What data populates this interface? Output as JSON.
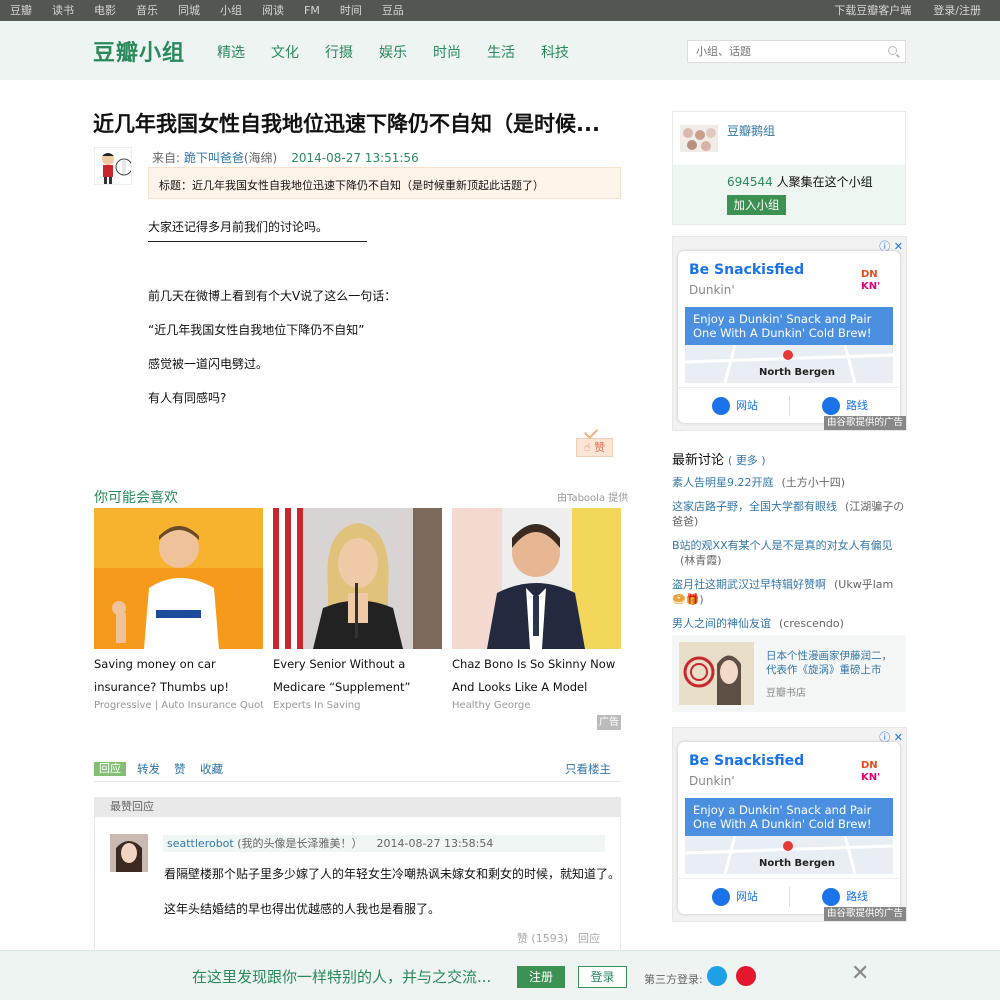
{
  "topbar": {
    "nav": [
      "豆瓣",
      "读书",
      "电影",
      "音乐",
      "同城",
      "小组",
      "阅读",
      "FM",
      "时间",
      "豆品"
    ],
    "download": "下载豆瓣客户端",
    "login": "登录/注册"
  },
  "header": {
    "logo": "豆瓣小组",
    "categories": [
      "精选",
      "文化",
      "行摄",
      "娱乐",
      "时尚",
      "生活",
      "科技"
    ],
    "search_placeholder": "小组、话题"
  },
  "article": {
    "title": "近几年我国女性自我地位迅速下降仍不自知（是时候...",
    "from_label": "来自: ",
    "author": "跪下叫爸爸",
    "location": "(海绵)",
    "date": "2014-08-27 13:51:56",
    "title_box": "标题：近几年我国女性自我地位迅速下降仍不自知（是时候重新顶起此话题了）",
    "paragraphs": [
      "大家还记得多月前我们的讨论吗。",
      "前几天在微博上看到有个大V说了这么一句话：",
      "“近几年我国女性自我地位下降仍不自知”",
      "感觉被一道闪电劈过。",
      "有人有同感吗?"
    ],
    "like_label": "赞"
  },
  "recommend": {
    "title": "你可能会喜欢",
    "source": "由Taboola 提供",
    "cards": [
      {
        "caption": "Saving money on car insurance? Thumbs up!",
        "sponsor": "Progressive | Auto Insurance Quotes"
      },
      {
        "caption": "Every Senior Without a Medicare “Supplement” Policy Should Do...",
        "sponsor": "Experts In Saving"
      },
      {
        "caption": "Chaz Bono Is So Skinny Now And Looks Like A Model (Photos)",
        "sponsor": "Healthy George"
      }
    ],
    "ad_tag": "广告"
  },
  "actions": {
    "reply": "回应",
    "share": "转发",
    "like": "赞",
    "collect": "收藏",
    "op_only": "只看楼主"
  },
  "best_replies": {
    "heading": "最赞回应",
    "reply": {
      "name": "seattlerobot",
      "note": " (我的头像是长泽雅美！）",
      "time": "2014-08-27 13:58:54",
      "line1": "看隔壁楼那个贴子里多少嫁了人的年轻女生冷嘲热讽未嫁女和剩女的时候，就知道了。",
      "line2": "这年头结婚结的早也得出优越感的人我也是看服了。",
      "likes": "赞 (1593)",
      "reply_label": "回应"
    }
  },
  "sidebar": {
    "group": {
      "name": "豆瓣鹅组",
      "count": "694544",
      "count_suffix": " 人聚集在这个小组",
      "join": "加入小组"
    },
    "ad": {
      "headline": "Be Snackisfied",
      "brand": "Dunkin'",
      "banner": "Enjoy a Dunkin' Snack and Pair One With A Dunkin' Cold Brew!",
      "place": "North Bergen",
      "website": "网站",
      "route": "路线",
      "footer": "由谷歌提供的广告",
      "logo_text": "DNKN'"
    },
    "latest": {
      "title": "最新讨论",
      "more": "更多",
      "items": [
        {
          "title": "素人告明星9.22开庭",
          "group": "(土方小十四)"
        },
        {
          "title": "这家店路子野，全国大学都有眼线",
          "group": "(江湖骗子の爸爸)"
        },
        {
          "title": "B站的观XX有某个人是不是真的对女人有偏见",
          "group": "(林青霞)"
        },
        {
          "title": "盗月社这期武汉过早特辑好赞啊",
          "group": "(Ukw乎lam🥯🎁)"
        },
        {
          "title": "男人之间的神仙友谊",
          "group": "(crescendo)"
        }
      ]
    },
    "book": {
      "text": "日本个性漫画家伊藤润二，代表作《旋涡》重磅上市",
      "source": "豆瓣书店"
    }
  },
  "bottombar": {
    "slogan": "在这里发现跟你一样特别的人，并与之交流...",
    "register": "注册",
    "login": "登录",
    "third_party": "第三方登录:"
  },
  "colors": {
    "brand_green": "#2a8a5c",
    "link_blue": "#3377aa",
    "button_green": "#3d9152"
  }
}
